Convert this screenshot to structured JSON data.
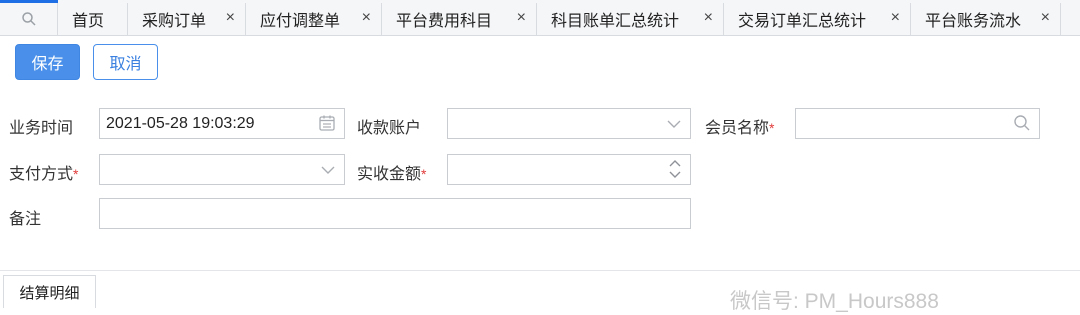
{
  "tabs": [
    {
      "label": "首页",
      "closable": false
    },
    {
      "label": "采购订单",
      "closable": true
    },
    {
      "label": "应付调整单",
      "closable": true
    },
    {
      "label": "平台费用科目",
      "closable": true
    },
    {
      "label": "科目账单汇总统计",
      "closable": true
    },
    {
      "label": "交易订单汇总统计",
      "closable": true
    },
    {
      "label": "平台账务流水",
      "closable": true
    }
  ],
  "tab_close_glyph": "×",
  "toolbar": {
    "save_label": "保存",
    "cancel_label": "取消"
  },
  "form": {
    "business_time": {
      "label": "业务时间",
      "value": "2021-05-28 19:03:29"
    },
    "receiving_account": {
      "label": "收款账户",
      "value": ""
    },
    "member_name": {
      "label": "会员名称",
      "required_mark": "*",
      "value": ""
    },
    "payment_method": {
      "label": "支付方式",
      "required_mark": "*",
      "value": ""
    },
    "received_amount": {
      "label": "实收金额",
      "required_mark": "*",
      "value": ""
    },
    "remark": {
      "label": "备注",
      "value": ""
    }
  },
  "section": {
    "tab_label": "结算明细"
  },
  "watermark": "微信号: PM_Hours888",
  "colors": {
    "accent": "#4a90ea",
    "required": "#e23b3b",
    "tab_indicator": "#1e6fe6"
  },
  "icons": [
    "search-icon",
    "close-icon",
    "calendar-icon",
    "chevron-down-icon",
    "stepper-icon"
  ]
}
